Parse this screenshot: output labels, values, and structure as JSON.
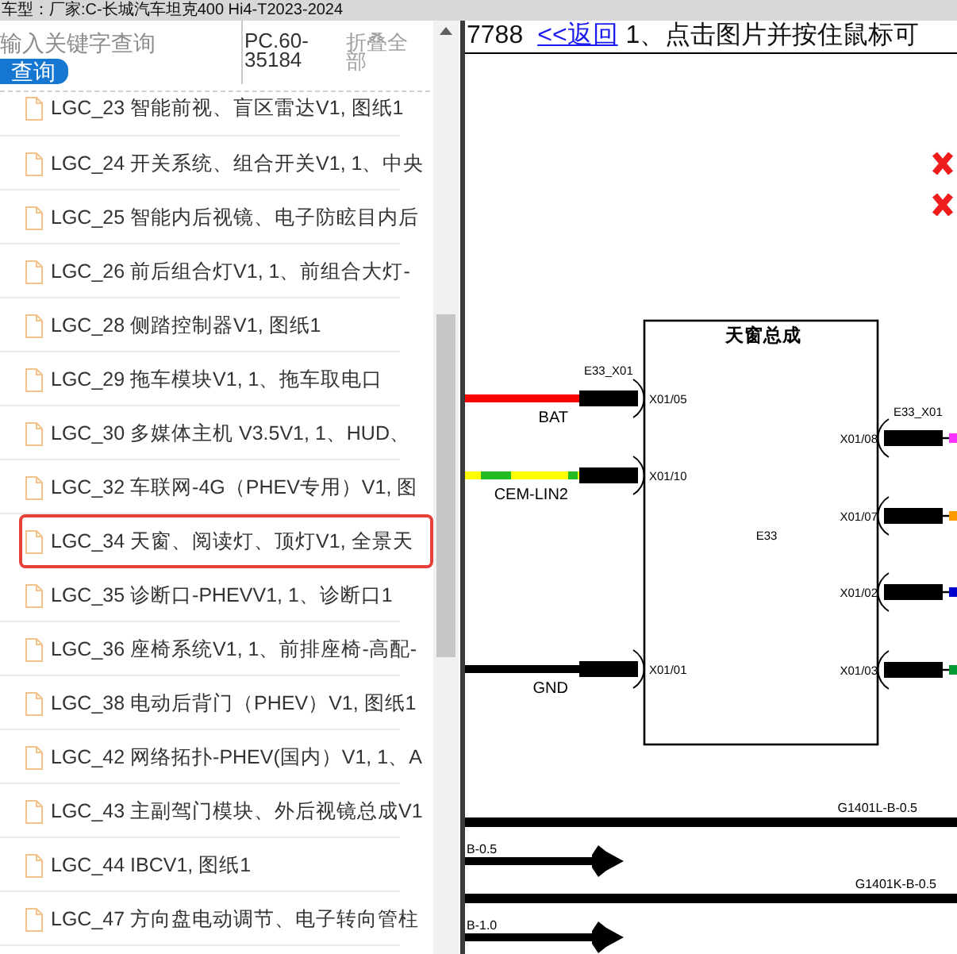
{
  "header": {
    "vehicle": "车型：厂家:C-长城汽车坦克400 Hi4-T2023-2024"
  },
  "sidebar": {
    "search": {
      "placeholder": "输入关键字查询",
      "button": "查询"
    },
    "code": "PC.60-35184",
    "collapse": "折叠全部",
    "items": [
      {
        "label": "LGC_23 智能前视、盲区雷达V1, 图纸1",
        "selected": false
      },
      {
        "label": "LGC_24 开关系统、组合开关V1, 1、中央",
        "selected": false
      },
      {
        "label": "LGC_25 智能内后视镜、电子防眩目内后",
        "selected": false
      },
      {
        "label": "LGC_26 前后组合灯V1, 1、前组合大灯-",
        "selected": false
      },
      {
        "label": "LGC_28 侧踏控制器V1, 图纸1",
        "selected": false
      },
      {
        "label": "LGC_29 拖车模块V1, 1、拖车取电口",
        "selected": false
      },
      {
        "label": "LGC_30 多媒体主机 V3.5V1, 1、HUD、",
        "selected": false
      },
      {
        "label": "LGC_32 车联网-4G（PHEV专用）V1, 图",
        "selected": false
      },
      {
        "label": "LGC_34 天窗、阅读灯、顶灯V1, 全景天",
        "selected": true
      },
      {
        "label": "LGC_35 诊断口-PHEVV1, 1、诊断口1",
        "selected": false
      },
      {
        "label": "LGC_36 座椅系统V1, 1、前排座椅-高配-",
        "selected": false
      },
      {
        "label": "LGC_38 电动后背门（PHEV）V1, 图纸1",
        "selected": false
      },
      {
        "label": "LGC_42 网络拓扑-PHEV(国内）V1, 1、A",
        "selected": false
      },
      {
        "label": "LGC_43 主副驾门模块、外后视镜总成V1",
        "selected": false
      },
      {
        "label": "LGC_44 IBCV1, 图纸1",
        "selected": false
      },
      {
        "label": "LGC_47 方向盘电动调节、电子转向管柱",
        "selected": false
      }
    ]
  },
  "viewer": {
    "document_number": "7788",
    "back_link": "<<返回",
    "hint": "1、点击图片并按住鼠标可",
    "diagram": {
      "title": "天窗总成",
      "module": "E33",
      "left_connector": "E33_X01",
      "right_connector": "E33_X01",
      "left_pins": [
        {
          "pin": "X01/05",
          "wire": "BAT",
          "color": "#ff0000"
        },
        {
          "pin": "X01/10",
          "wire": "CEM-LIN2",
          "color": "#ffff00",
          "stripe": {
            "color": "#22bb22"
          }
        },
        {
          "pin": "X01/01",
          "wire": "GND",
          "color": "#000000"
        }
      ],
      "right_pins": [
        {
          "pin": "X01/08",
          "color": "#ff33ff"
        },
        {
          "pin": "X01/07",
          "color": "#ff9900"
        },
        {
          "pin": "X01/02",
          "color": "#0000cc"
        },
        {
          "pin": "X01/03",
          "color": "#009933"
        }
      ],
      "ground_lines": [
        {
          "label": "G1401L-B-0.5",
          "branch": "B-0.5"
        },
        {
          "label": "G1401K-B-0.5",
          "branch": "B-1.0"
        }
      ]
    }
  }
}
